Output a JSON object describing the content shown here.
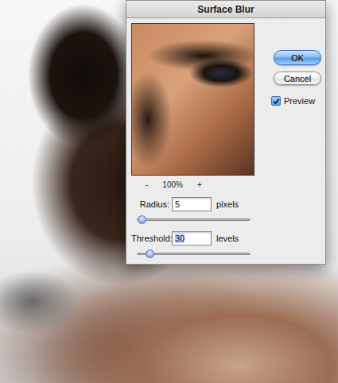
{
  "window": {
    "title": "Surface Blur"
  },
  "preview": {
    "zoom_out": "-",
    "zoom": "100%",
    "zoom_in": "+"
  },
  "fields": [
    {
      "label": "Radius:",
      "value": "5",
      "unit": "pixels",
      "level": 0.04,
      "selected": false
    },
    {
      "label": "Threshold:",
      "value": "30",
      "unit": "levels",
      "level": 0.11,
      "selected": true
    }
  ],
  "buttons": [
    {
      "label": "OK",
      "default": true
    },
    {
      "label": "Cancel",
      "default": false
    }
  ],
  "checkbox": {
    "label": "Preview",
    "checked": true
  }
}
